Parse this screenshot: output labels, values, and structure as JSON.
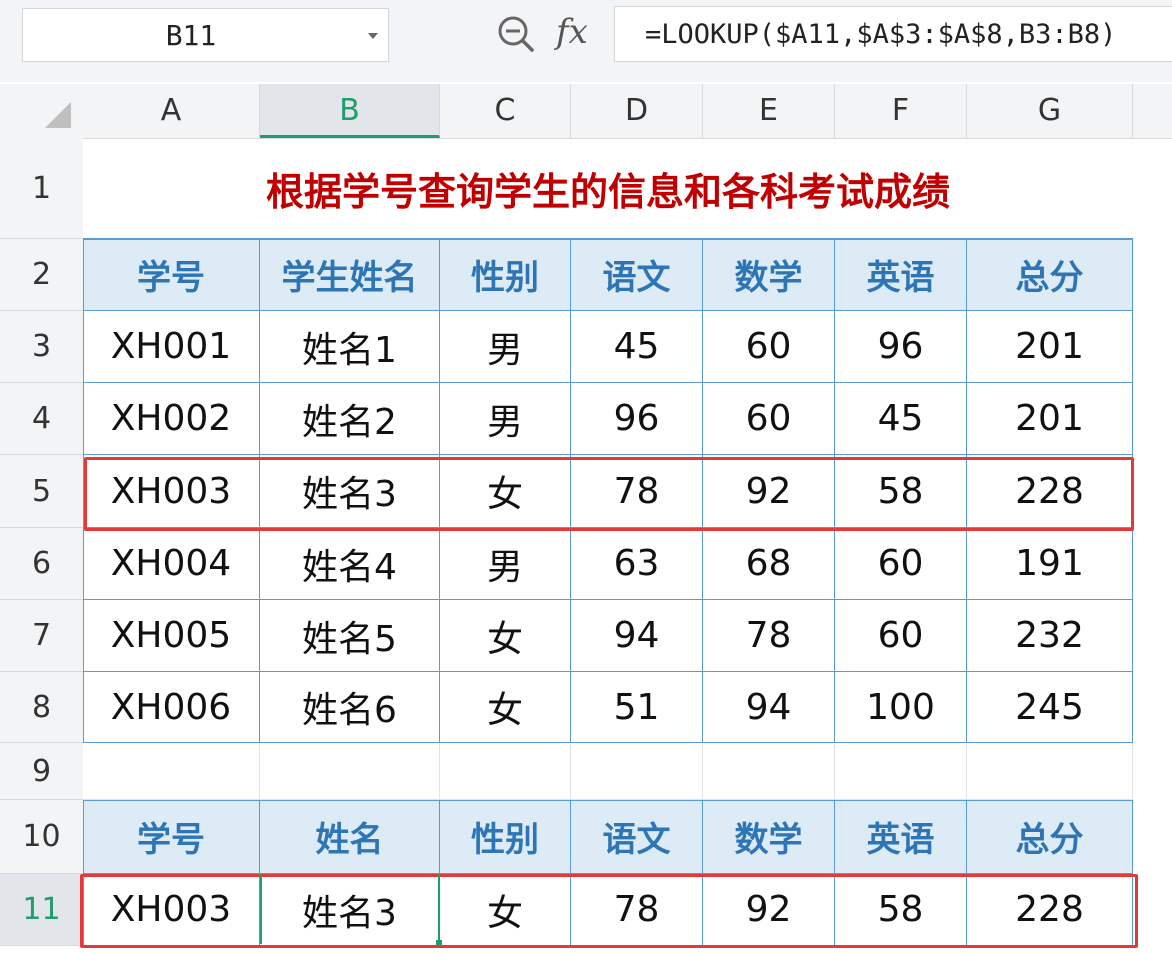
{
  "name_box": {
    "value": "B11"
  },
  "formula_bar": {
    "formula": "=LOOKUP($A11,$A$3:$A$8,B3:B8)"
  },
  "columns": [
    "A",
    "B",
    "C",
    "D",
    "E",
    "F",
    "G"
  ],
  "rows": [
    "1",
    "2",
    "3",
    "4",
    "5",
    "6",
    "7",
    "8",
    "9",
    "10",
    "11"
  ],
  "title": "根据学号查询学生的信息和各科考试成绩",
  "table_headers": [
    "学号",
    "学生姓名",
    "性别",
    "语文",
    "数学",
    "英语",
    "总分"
  ],
  "table_rows": [
    [
      "XH001",
      "姓名1",
      "男",
      "45",
      "60",
      "96",
      "201"
    ],
    [
      "XH002",
      "姓名2",
      "男",
      "96",
      "60",
      "45",
      "201"
    ],
    [
      "XH003",
      "姓名3",
      "女",
      "78",
      "92",
      "58",
      "228"
    ],
    [
      "XH004",
      "姓名4",
      "男",
      "63",
      "68",
      "60",
      "191"
    ],
    [
      "XH005",
      "姓名5",
      "女",
      "94",
      "78",
      "60",
      "232"
    ],
    [
      "XH006",
      "姓名6",
      "女",
      "51",
      "94",
      "100",
      "245"
    ]
  ],
  "lookup_headers": [
    "学号",
    "姓名",
    "性别",
    "语文",
    "数学",
    "英语",
    "总分"
  ],
  "lookup_row": [
    "XH003",
    "姓名3",
    "女",
    "78",
    "92",
    "58",
    "228"
  ],
  "active_cell": {
    "column": "B",
    "row": "11"
  },
  "colors": {
    "title": "#c00000",
    "header_text": "#2e75b6",
    "header_bg": "#ddebf7",
    "highlight": "#e23a3a",
    "active": "#1f9d6b"
  }
}
